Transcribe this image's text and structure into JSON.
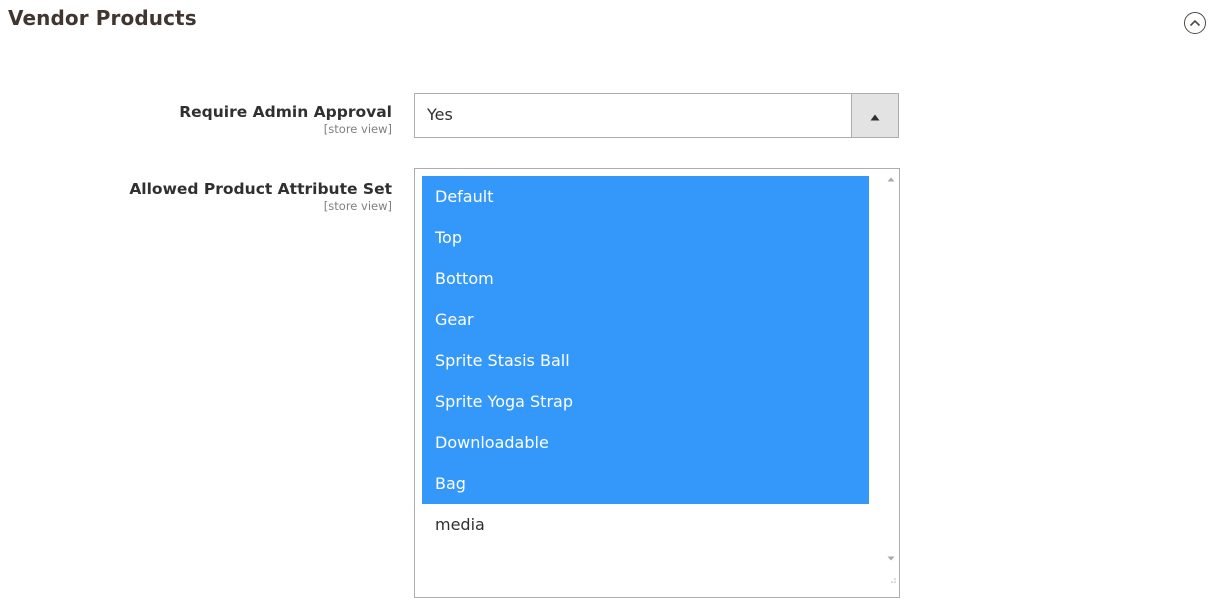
{
  "section": {
    "title": "Vendor Products",
    "collapse_icon": "chevron-up-circle-icon"
  },
  "fields": {
    "require_admin_approval": {
      "label": "Require Admin Approval",
      "scope": "[store view]",
      "value": "Yes",
      "arrow_icon": "triangle-up-icon"
    },
    "allowed_attribute_set": {
      "label": "Allowed Product Attribute Set",
      "scope": "[store view]",
      "options": [
        {
          "label": "Default",
          "selected": true
        },
        {
          "label": "Top",
          "selected": true
        },
        {
          "label": "Bottom",
          "selected": true
        },
        {
          "label": "Gear",
          "selected": true
        },
        {
          "label": "Sprite Stasis Ball",
          "selected": true
        },
        {
          "label": "Sprite Yoga Strap",
          "selected": true
        },
        {
          "label": "Downloadable",
          "selected": true
        },
        {
          "label": "Bag",
          "selected": true
        },
        {
          "label": "media",
          "selected": false
        }
      ]
    }
  },
  "colors": {
    "selected_bg": "#3498fb",
    "selected_text": "#ffffff",
    "border": "#adadad"
  }
}
